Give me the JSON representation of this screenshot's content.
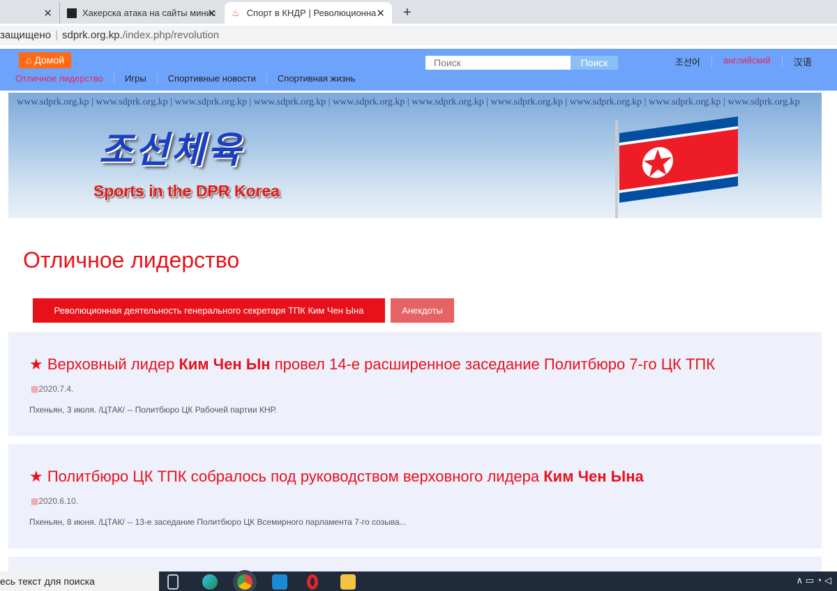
{
  "browser": {
    "tabs": [
      {
        "title": "Хакерска атака на сайты минис"
      },
      {
        "title": "Спорт в КНДР | Революционна"
      }
    ],
    "new_tab": "+",
    "security": "защищено",
    "url_host": "sdprk.org.kp.",
    "url_path": "/index.php/revolution"
  },
  "nav": {
    "home": "Домой",
    "menu": [
      "Отличное лидерство",
      "Игры",
      "Спортивные новости",
      "Спортивная жизнь"
    ],
    "search_placeholder": "Поиск",
    "search_button": "Поиск",
    "languages": [
      "조선어",
      "английский",
      "汉语"
    ]
  },
  "banner": {
    "watermark": "www.sdprk.org.kp | www.sdprk.org.kp | www.sdprk.org.kp | www.sdprk.org.kp | www.sdprk.org.kp | www.sdprk.org.kp | www.sdprk.org.kp | www.sdprk.org.kp | www.sdprk.org.kp | www.sdprk.org.kp",
    "logo_korean": "조선체육",
    "logo_english": "Sports in the DPR Korea"
  },
  "page": {
    "title": "Отличное лидерство",
    "buttons": [
      "Революционная деятельность генерального секретаря ТПК Ким Чен Ына",
      "Анекдоты"
    ],
    "articles": [
      {
        "pre": "Верховный лидер ",
        "bold": "Ким Чен Ын",
        "post": " провел 14-е расширенное заседание Политбюро 7-го ЦК ТПК",
        "date": "2020.7.4.",
        "summary": "Пхеньян, 3 июля. /ЦТАК/ -- Политбюро ЦК Рабочей партии КНР."
      },
      {
        "pre": "Политбюро ЦК ТПК собралось под руководством верховного лидера ",
        "bold": "Ким Чен Ына",
        "post": "",
        "date": "2020.6.10.",
        "summary": "Пхеньян, 8 июня. /ЦТАК/ -- 13-е заседание Политбюро ЦК Всемирного парламента 7-го созыва..."
      }
    ]
  },
  "taskbar": {
    "search_text": "есь текст для поиска"
  }
}
